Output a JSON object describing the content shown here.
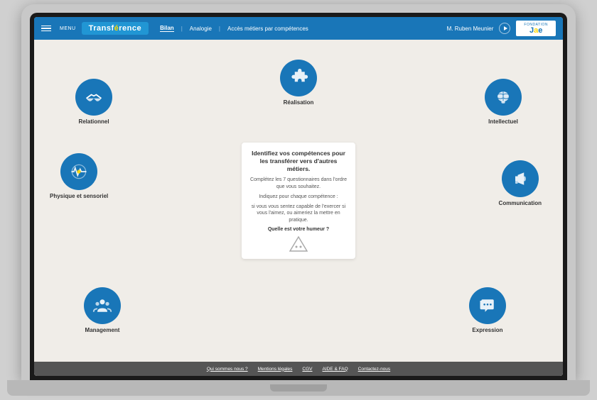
{
  "app": {
    "brand": "Transf",
    "brand_accent": "é",
    "brand_rest": "rence",
    "menu_label": "MENU"
  },
  "navbar": {
    "links": [
      {
        "label": "Bilan",
        "active": true
      },
      {
        "label": "Analogie",
        "active": false
      },
      {
        "label": "Accès métiers par compétences",
        "active": false
      }
    ],
    "user": "M. Ruben Meunier",
    "logo_prefix": "fondation",
    "logo_j": "J",
    "logo_a": "a",
    "logo_e": "e"
  },
  "center_card": {
    "title": "Identifiez vos compétences pour les transférer vers d'autres métiers.",
    "text1": "Complétez les 7 questionnaires dans l'ordre que vous souhaitez.",
    "text2": "Indiquez pour chaque compétence :",
    "text3": "si vous vous sentez capable de l'exercer si vous l'aimez, ou aimeriez la mettre en pratique.",
    "bold": "Quelle est votre humeur ?"
  },
  "competences": [
    {
      "id": "realisation",
      "label": "Réalisation",
      "position": "top-center"
    },
    {
      "id": "intellectuel",
      "label": "Intellectuel",
      "position": "top-right"
    },
    {
      "id": "communication",
      "label": "Communication",
      "position": "right"
    },
    {
      "id": "expression",
      "label": "Expression",
      "position": "bottom-right"
    },
    {
      "id": "management",
      "label": "Management",
      "position": "bottom-left"
    },
    {
      "id": "physique",
      "label": "Physique et sensoriel",
      "position": "left"
    },
    {
      "id": "relationnel",
      "label": "Relationnel",
      "position": "top-left"
    }
  ],
  "footer": {
    "links": [
      "Qui sommes nous ?",
      "Mentions légales",
      "CGV",
      "AIDE & FAQ",
      "Contactez-nous"
    ]
  }
}
